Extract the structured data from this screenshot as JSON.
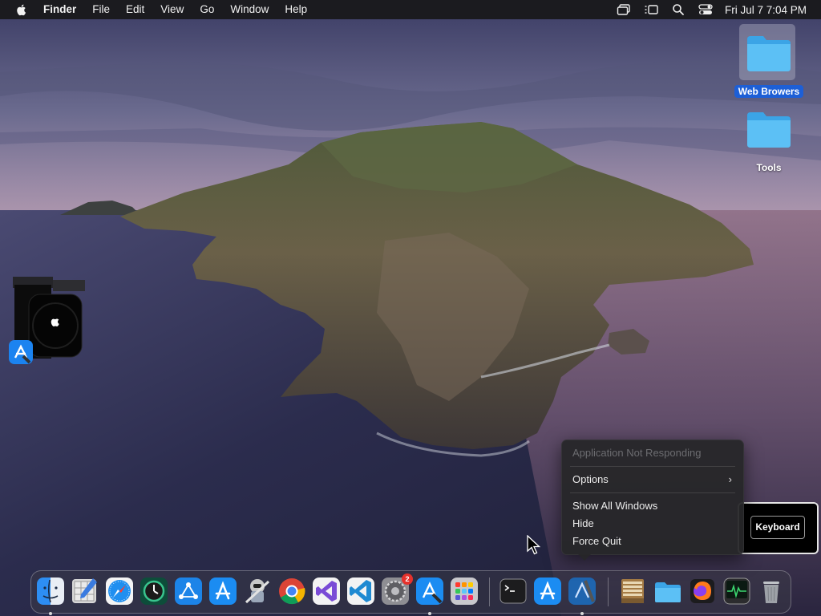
{
  "menubar": {
    "app_name": "Finder",
    "menus": [
      "File",
      "Edit",
      "View",
      "Go",
      "Window",
      "Help"
    ],
    "clock": "Fri Jul 7  7:04 PM",
    "tray_icons": [
      "window-switcher-icon",
      "stage-manager-icon",
      "spotlight-search-icon",
      "control-center-icon"
    ]
  },
  "desktop": {
    "icons": [
      {
        "label": "Web Browers",
        "selected": true,
        "icon": "folder-icon"
      },
      {
        "label": "Tools",
        "selected": false,
        "icon": "folder-icon"
      }
    ]
  },
  "context_menu": {
    "header": "Application Not Responding",
    "options": "Options",
    "show_all": "Show All Windows",
    "hide": "Hide",
    "force_quit": "Force Quit"
  },
  "keyboard_popover": {
    "button_label": "Keyboard"
  },
  "dock": {
    "apps": [
      "Finder",
      "Preview",
      "Safari",
      "Time Machine",
      "Network Utility",
      "App Store",
      "Xcode Instruments",
      "Google Chrome",
      "Visual Studio",
      "Visual Studio Code",
      "System Settings",
      "Simulator",
      "Launchpad",
      "Terminal",
      "App Store",
      "Xcode",
      "Archive Utility",
      "Folder",
      "Firefox",
      "Activity Monitor",
      "Trash"
    ],
    "system_settings_badge": "2"
  },
  "colors": {
    "menubar_bg": "#1b1b1f",
    "selection_blue": "#1d5fd6",
    "folder_blue": "#4fb7f2",
    "badge_red": "#e5322d"
  }
}
